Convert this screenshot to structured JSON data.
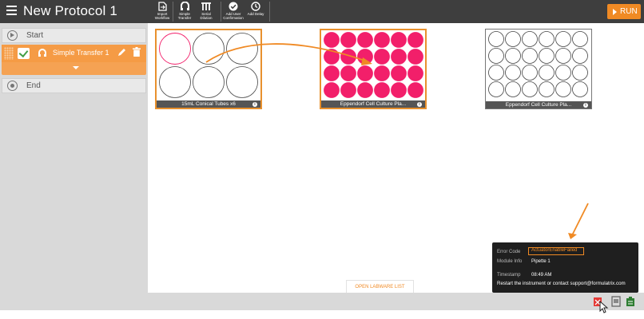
{
  "header": {
    "title": "New Protocol 1",
    "tools": [
      {
        "icon": "import-workflow-icon",
        "label": "Import Workflow"
      },
      {
        "icon": "simple-transfer-icon",
        "label": "Simple Transfer"
      },
      {
        "icon": "serial-dilution-icon",
        "label": "Serial Dilution"
      },
      {
        "icon": "add-user-confirmation-icon",
        "label": "Add User Confirmation"
      },
      {
        "icon": "add-delay-icon",
        "label": "Add Delay"
      }
    ],
    "run_label": "RUN",
    "accent_color": "#f08a24"
  },
  "sidebar": {
    "start_label": "Start",
    "step_label": "Simple Transfer 1",
    "end_label": "End"
  },
  "labware": [
    {
      "name": "15mL Conical Tubes x6"
    },
    {
      "name": "Eppendorf Cell Culture Pla..."
    },
    {
      "name": "Eppendorf Cell Culture Pla..."
    }
  ],
  "colors": {
    "well_fill": "#f21f6a",
    "selected_border": "#e8912e",
    "error_badge": "#f08a24"
  },
  "open_list_label": "OPEN LABWARE LIST",
  "error": {
    "code_label": "Error Code",
    "code_value": "ActuatorEnableFailed",
    "module_label": "Module Info",
    "module_value": "Pipette 1",
    "timestamp_label": "Timestamp",
    "timestamp_value": "08:49 AM",
    "message": "Restart the instrument or contact support@formulatrix.com"
  },
  "status_icons": [
    "error-notification-icon",
    "log-icon",
    "clipboard-icon"
  ]
}
